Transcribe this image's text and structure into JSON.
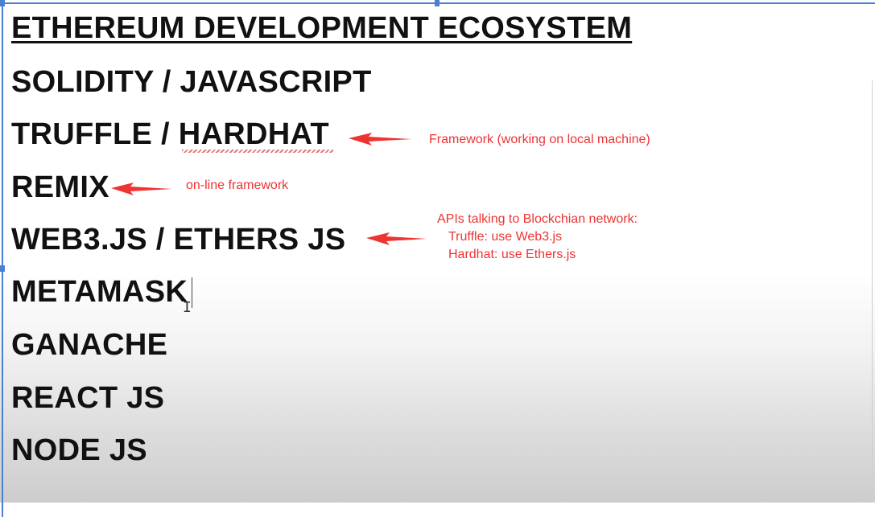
{
  "slide": {
    "title": "ETHEREUM DEVELOPMENT ECOSYSTEM",
    "items": [
      "SOLIDITY / JAVASCRIPT",
      "TRUFFLE / HARDHAT",
      "REMIX",
      "WEB3.JS / ETHERS JS",
      "METAMASK",
      "GANACHE",
      "REACT JS",
      "NODE JS"
    ]
  },
  "annotations": {
    "framework": "Framework (working on local machine)",
    "online": "on-line framework",
    "apis_line1": "APIs talking to Blockchian network:",
    "apis_line2": "Truffle: use Web3.js",
    "apis_line3": "Hardhat: use Ethers.js"
  },
  "colors": {
    "annotation": "#ee3333",
    "selection": "#4a7fd4",
    "text": "#111111"
  },
  "icons": {
    "cursor": "i-beam-cursor-icon"
  }
}
